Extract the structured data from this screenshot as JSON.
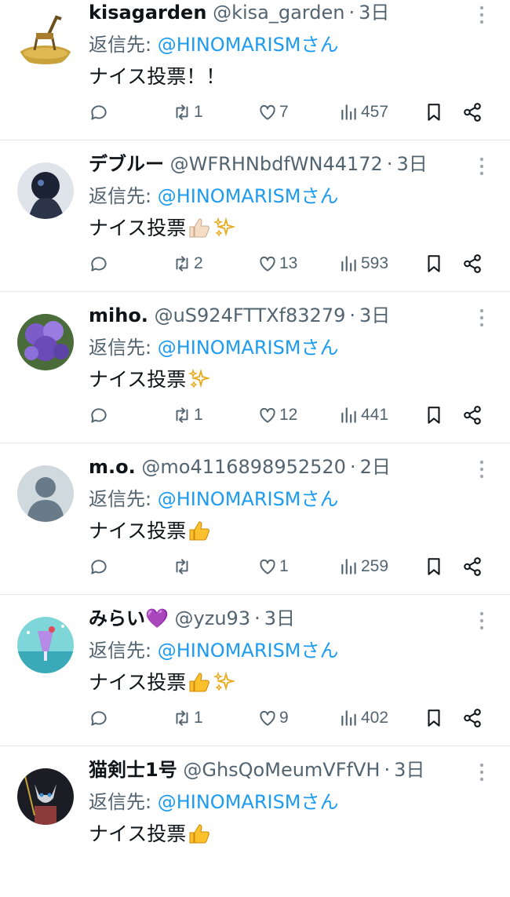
{
  "reply_prefix": "返信先: ",
  "tweets": [
    {
      "name": "kisagarden",
      "handle": "@kisa_garden",
      "time": "3日",
      "mention": "@HINOMARISMさん",
      "text": "ナイス投票！！",
      "emojis": [],
      "replies": "",
      "retweets": "1",
      "likes": "7",
      "views": "457",
      "avatar": "giraffe-sculpture"
    },
    {
      "name": "デブルー",
      "handle": "@WFRHNbdfWN44172",
      "time": "3日",
      "mention": "@HINOMARISMさん",
      "text": "ナイス投票",
      "emojis": [
        "thumbs-up-light",
        "sparkles"
      ],
      "replies": "",
      "retweets": "2",
      "likes": "13",
      "views": "593",
      "avatar": "dark-figure"
    },
    {
      "name": "miho.",
      "handle": "@uS924FTTXf83279",
      "time": "3日",
      "mention": "@HINOMARISMさん",
      "text": "ナイス投票",
      "emojis": [
        "sparkles"
      ],
      "replies": "",
      "retweets": "1",
      "likes": "12",
      "views": "441",
      "avatar": "hydrangea"
    },
    {
      "name": "m.o.",
      "handle": "@mo4116898952520",
      "time": "2日",
      "mention": "@HINOMARISMさん",
      "text": "ナイス投票",
      "emojis": [
        "thumbs-up"
      ],
      "replies": "",
      "retweets": "",
      "likes": "1",
      "views": "259",
      "avatar": "default-person"
    },
    {
      "name": "みらい",
      "name_emoji": "💜",
      "handle": "@yzu93",
      "time": "3日",
      "mention": "@HINOMARISMさん",
      "text": "ナイス投票",
      "emojis": [
        "thumbs-up",
        "sparkles"
      ],
      "replies": "",
      "retweets": "1",
      "likes": "9",
      "views": "402",
      "avatar": "purple-drink"
    },
    {
      "name": "猫剣士1号",
      "handle": "@GhsQoMeumVFfVH",
      "time": "3日",
      "mention": "@HINOMARISMさん",
      "text": "ナイス投票",
      "emojis": [
        "thumbs-up"
      ],
      "avatar": "cat-warrior"
    }
  ]
}
